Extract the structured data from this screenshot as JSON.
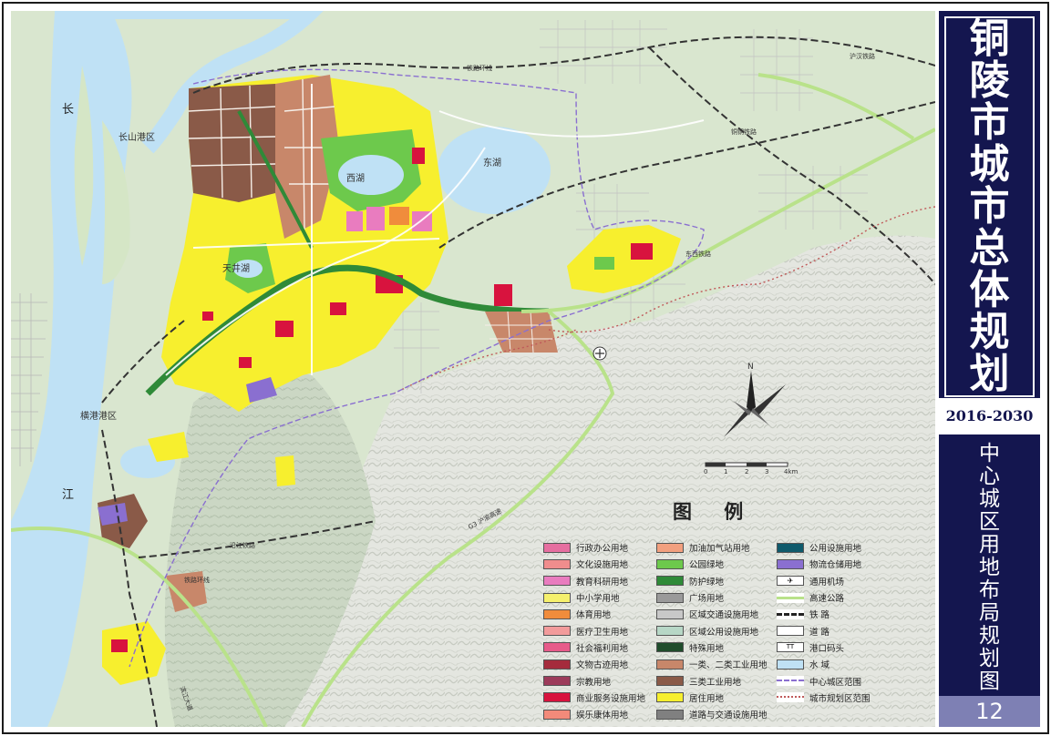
{
  "title_chars": [
    "铜",
    "陵",
    "市",
    "城",
    "市",
    "总",
    "体",
    "规",
    "划"
  ],
  "years": "2016-2030年",
  "subtitle_chars": [
    "中",
    "心",
    "城",
    "区",
    "用",
    "地",
    "布",
    "局",
    "规",
    "划",
    "图"
  ],
  "page_number": "12",
  "map_labels": {
    "chang": "长",
    "jiang": "江",
    "changshan_port": "长山港区",
    "xihu": "西湖",
    "donghu": "东湖",
    "tianjinghu": "天井湖",
    "hengang_port": "横港港区",
    "rail_1": "铁路环线",
    "rail_2": "铁路环线",
    "rail_3": "铜铜铁路",
    "rail_4": "沪汉铁路",
    "rail_5": "东西铁路",
    "rail_6": "沿江铁路",
    "expressway": "G3 沪渝高速",
    "road_a": "滨江大道"
  },
  "scale_bar": {
    "ticks": [
      "0",
      "1",
      "2",
      "3",
      "4km"
    ]
  },
  "compass_label": "N",
  "legend": {
    "title": "图  例",
    "col1": [
      {
        "label": "行政办公用地",
        "color": "#e66fa0"
      },
      {
        "label": "文化设施用地",
        "color": "#f08d8d"
      },
      {
        "label": "教育科研用地",
        "color": "#e97cbf"
      },
      {
        "label": "中小学用地",
        "color": "#f5f06d"
      },
      {
        "label": "体育用地",
        "color": "#f08c3c"
      },
      {
        "label": "医疗卫生用地",
        "color": "#f29b9b"
      },
      {
        "label": "社会福利用地",
        "color": "#e75b8a"
      },
      {
        "label": "文物古迹用地",
        "color": "#a52b3c"
      },
      {
        "label": "宗教用地",
        "color": "#9c3b5a"
      },
      {
        "label": "商业服务设施用地",
        "color": "#d8133e"
      },
      {
        "label": "娱乐康体用地",
        "color": "#f38a7a"
      }
    ],
    "col2": [
      {
        "label": "加油加气站用地",
        "color": "#f2a07f"
      },
      {
        "label": "公园绿地",
        "color": "#6dc94c"
      },
      {
        "label": "防护绿地",
        "color": "#2f8a38"
      },
      {
        "label": "广场用地",
        "color": "#9a9a9a"
      },
      {
        "label": "区域交通设施用地",
        "color": "#c8c8c8"
      },
      {
        "label": "区域公用设施用地",
        "color": "#b7d7c6"
      },
      {
        "label": "特殊用地",
        "color": "#204d2c"
      },
      {
        "label": "一类、二类工业用地",
        "color": "#c8876a"
      },
      {
        "label": "三类工业用地",
        "color": "#8a5a48"
      },
      {
        "label": "居住用地",
        "color": "#f7ef2e"
      },
      {
        "label": "道路与交通设施用地",
        "color": "#808080"
      }
    ],
    "col3": [
      {
        "label": "公用设施用地",
        "color": "#0f5a6b"
      },
      {
        "label": "物流仓储用地",
        "color": "#8a6fd0"
      },
      {
        "label": "通用机场",
        "color": "#ffffff"
      },
      {
        "label": "高速公路",
        "color": "#b9e28a"
      },
      {
        "label": "铁     路",
        "color": "#ffffff"
      },
      {
        "label": "道     路",
        "color": "#ffffff"
      },
      {
        "label": "港口码头",
        "color": "#ffffff"
      },
      {
        "label": "水     域",
        "color": "#bfe1f5"
      },
      {
        "label": "中心城区范围",
        "color": "#ffffff"
      },
      {
        "label": "城市规划区范围",
        "color": "#ffffff"
      }
    ],
    "symbols": {
      "airport": "✈",
      "port": "TT"
    }
  }
}
